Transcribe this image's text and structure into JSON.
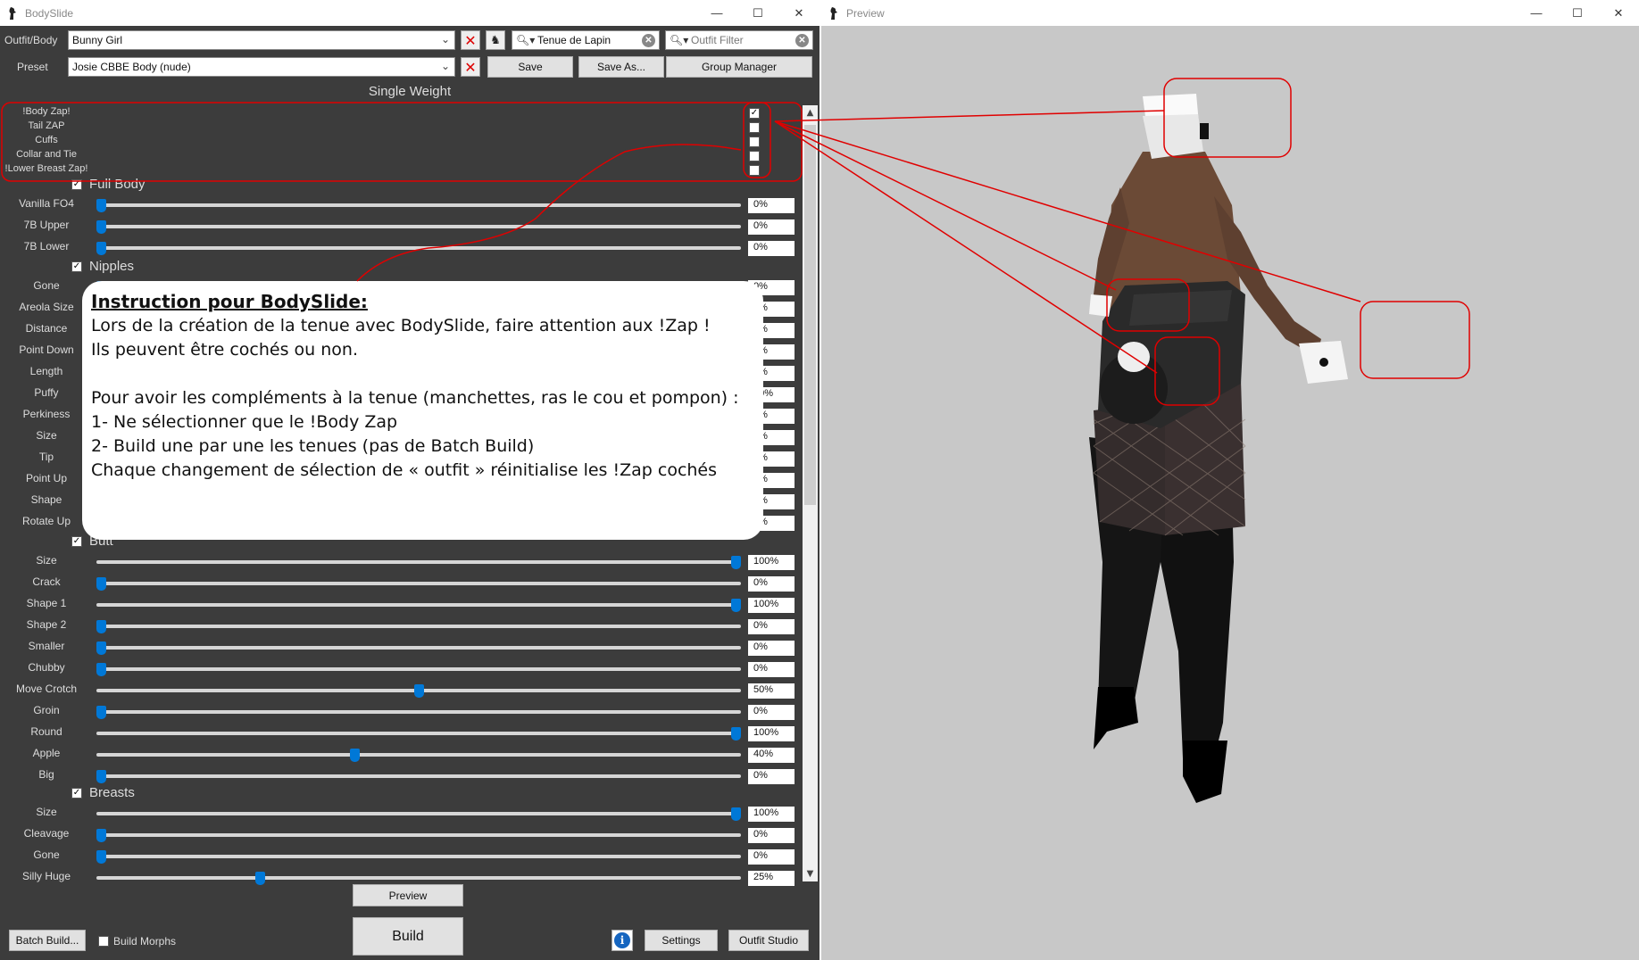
{
  "bodyslide": {
    "title": "BodySlide",
    "outfit_label": "Outfit/Body",
    "outfit_value": "Bunny Girl",
    "preset_label": "Preset",
    "preset_value": "Josie CBBE Body (nude)",
    "group_filter": "Tenue de Lapin",
    "outfit_filter_placeholder": "Outfit Filter",
    "save": "Save",
    "save_as": "Save As...",
    "group_manager": "Group Manager",
    "weight_title": "Single Weight",
    "zaps": [
      {
        "label": "!Body Zap!",
        "checked": true
      },
      {
        "label": "Tail ZAP",
        "checked": false
      },
      {
        "label": "Cuffs",
        "checked": false
      },
      {
        "label": "Collar and Tie",
        "checked": false
      },
      {
        "label": "!Lower Breast Zap!",
        "checked": false
      }
    ],
    "groups": [
      {
        "name": "Full Body",
        "sliders": [
          {
            "label": "Vanilla FO4",
            "value": 0,
            "text": "0%"
          },
          {
            "label": "7B Upper",
            "value": 0,
            "text": "0%"
          },
          {
            "label": "7B Lower",
            "value": 0,
            "text": "0%"
          }
        ]
      },
      {
        "name": "Nipples",
        "sliders": [
          {
            "label": "Gone",
            "value": 0,
            "text": "0%"
          },
          {
            "label": "Areola Size",
            "value": 0,
            "text": "0%"
          },
          {
            "label": "Distance",
            "value": 0,
            "text": "0%"
          },
          {
            "label": "Point Down",
            "value": 0,
            "text": "0%"
          },
          {
            "label": "Length",
            "value": 0,
            "text": "0%"
          },
          {
            "label": "Puffy",
            "value": 20,
            "text": "20%"
          },
          {
            "label": "Perkiness",
            "value": 0,
            "text": "0%"
          },
          {
            "label": "Size",
            "value": 0,
            "text": "0%"
          },
          {
            "label": "Tip",
            "value": 0,
            "text": "0%"
          },
          {
            "label": "Point Up",
            "value": 0,
            "text": "0%"
          },
          {
            "label": "Shape",
            "value": 0,
            "text": "0%"
          },
          {
            "label": "Rotate Up",
            "value": 0,
            "text": "0%"
          }
        ]
      },
      {
        "name": "Butt",
        "sliders": [
          {
            "label": "Size",
            "value": 100,
            "text": "100%"
          },
          {
            "label": "Crack",
            "value": 0,
            "text": "0%"
          },
          {
            "label": "Shape 1",
            "value": 100,
            "text": "100%"
          },
          {
            "label": "Shape 2",
            "value": 0,
            "text": "0%"
          },
          {
            "label": "Smaller",
            "value": 0,
            "text": "0%"
          },
          {
            "label": "Chubby",
            "value": 0,
            "text": "0%"
          },
          {
            "label": "Move Crotch",
            "value": 50,
            "text": "50%"
          },
          {
            "label": "Groin",
            "value": 0,
            "text": "0%"
          },
          {
            "label": "Round",
            "value": 100,
            "text": "100%"
          },
          {
            "label": "Apple",
            "value": 40,
            "text": "40%"
          },
          {
            "label": "Big",
            "value": 0,
            "text": "0%"
          }
        ]
      },
      {
        "name": "Breasts",
        "sliders": [
          {
            "label": "Size",
            "value": 100,
            "text": "100%"
          },
          {
            "label": "Cleavage",
            "value": 0,
            "text": "0%"
          },
          {
            "label": "Gone",
            "value": 0,
            "text": "0%"
          },
          {
            "label": "Silly Huge",
            "value": 25,
            "text": "25%"
          }
        ]
      }
    ],
    "preview_btn": "Preview",
    "build_btn": "Build",
    "batch_build_btn": "Batch Build...",
    "build_morphs_label": "Build Morphs",
    "settings_btn": "Settings",
    "outfit_studio_btn": "Outfit Studio"
  },
  "note": {
    "title": "Instruction pour BodySlide:",
    "lines": [
      "Lors de la création de la tenue avec BodySlide, faire attention aux !Zap !",
      "Ils peuvent être cochés ou non.",
      "",
      "Pour avoir les compléments à la tenue (manchettes, ras le cou et pompon) :",
      "1- Ne sélectionner que le !Body Zap",
      "2- Build une par une les tenues (pas de Batch Build)",
      "Chaque changement de sélection de « outfit » réinitialise les !Zap cochés"
    ]
  },
  "preview": {
    "title": "Preview"
  },
  "colors": {
    "panel": "#3c3c3c",
    "accent": "#0078d7",
    "annotation": "#e00000",
    "preview_bg": "#c8c8c8"
  }
}
